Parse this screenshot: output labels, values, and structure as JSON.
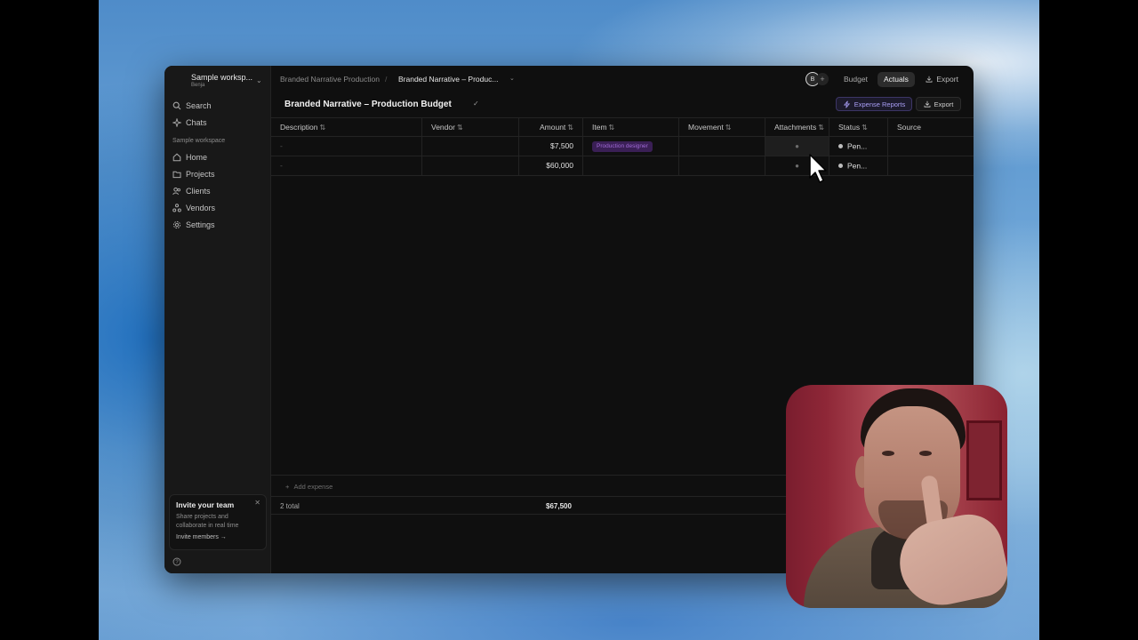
{
  "workspace": {
    "name": "Sample worksp...",
    "user": "Benja"
  },
  "sidebar": {
    "search_label": "Search",
    "chats_label": "Chats",
    "section_label": "Sample workspace",
    "items": [
      {
        "label": "Home",
        "icon": "home-icon"
      },
      {
        "label": "Projects",
        "icon": "folder-icon"
      },
      {
        "label": "Clients",
        "icon": "users-icon"
      },
      {
        "label": "Vendors",
        "icon": "vendors-icon"
      },
      {
        "label": "Settings",
        "icon": "gear-icon"
      }
    ],
    "invite": {
      "title": "Invite your team",
      "description": "Share projects and collaborate in real time",
      "link": "Invite members →"
    }
  },
  "header": {
    "breadcrumb_parent": "Branded Narrative Production",
    "breadcrumb_separator": "/",
    "breadcrumb_current": "Branded Narrative – Produc...",
    "avatar_initial": "B",
    "tabs": [
      "Budget",
      "Actuals"
    ],
    "active_tab": "Actuals",
    "export_label": "Export"
  },
  "page": {
    "title": "Branded Narrative – Production Budget",
    "expense_reports_label": "Expense Reports",
    "export_label": "Export"
  },
  "table": {
    "columns": [
      "Description",
      "Vendor",
      "Amount",
      "Item",
      "Movement",
      "Attachments",
      "Status",
      "Source"
    ],
    "rows": [
      {
        "description": "-",
        "vendor": "",
        "amount": "$7,500",
        "item": "Production designer",
        "movement": "",
        "status": "Pen..."
      },
      {
        "description": "-",
        "vendor": "",
        "amount": "$60,000",
        "item": "",
        "movement": "",
        "status": "Pen..."
      }
    ],
    "add_expense_label": "Add expense",
    "total_count": "2 total",
    "total_amount": "$67,500"
  },
  "colors": {
    "accent": "#a99ef5",
    "tag_background": "#3a1f55",
    "tag_text": "#a06ad6",
    "app_background": "#0f0f0f"
  }
}
